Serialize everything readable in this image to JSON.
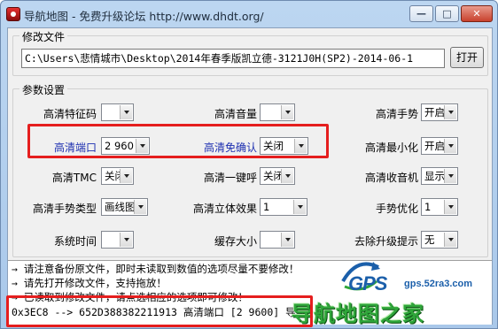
{
  "window": {
    "title": "导航地图 - 免费升级论坛 http://www.dhdt.org/",
    "buttons": {
      "min": "—",
      "max": "□",
      "close": "✕"
    }
  },
  "file_group": {
    "label": "修改文件",
    "path": "C:\\Users\\悲情城市\\Desktop\\2014年春季版凯立德-3121J0H(SP2)-2014-06-1",
    "open_button": "打开"
  },
  "params_group": {
    "label": "参数设置",
    "rows": [
      [
        {
          "label": "高清特征码",
          "value": ""
        },
        {
          "label": "高清音量",
          "value": ""
        },
        {
          "label": "高清手势",
          "value": "开启"
        }
      ],
      [
        {
          "label": "高清端口",
          "value": "2 960"
        },
        {
          "label": "高清免确认",
          "value": "关闭"
        },
        {
          "label": "高清最小化",
          "value": "开启"
        }
      ],
      [
        {
          "label": "高清TMC",
          "value": "关闭"
        },
        {
          "label": "高清一键呼",
          "value": "关闭"
        },
        {
          "label": "高清收音机",
          "value": "显示"
        }
      ],
      [
        {
          "label": "高清手势类型",
          "value": "画线图"
        },
        {
          "label": "高清立体效果",
          "value": "1"
        },
        {
          "label": "手势优化",
          "value": "1"
        }
      ],
      [
        {
          "label": "系统时间",
          "value": ""
        },
        {
          "label": "缓存大小",
          "value": ""
        },
        {
          "label": "去除升级提示",
          "value": "无"
        }
      ]
    ]
  },
  "log": {
    "lines": [
      "→ 请注意备份原文件，即时未读取到数值的选项尽量不要修改！",
      "→ 请先打开修改文件，支持拖放！",
      "→ 已读取到修改文件，请点选相应的选项即可修改！",
      "0x3EC8 --> 652D388382211913  高清端口  [2 9600] 导航"
    ]
  },
  "watermark": {
    "brand": "GPS",
    "url": "gps.52ra3.com",
    "site": "导航地图之家"
  },
  "colors": {
    "highlight": "#e51e1e",
    "blue_label": "#1d2fb0",
    "site_green": "#2fa63a"
  }
}
